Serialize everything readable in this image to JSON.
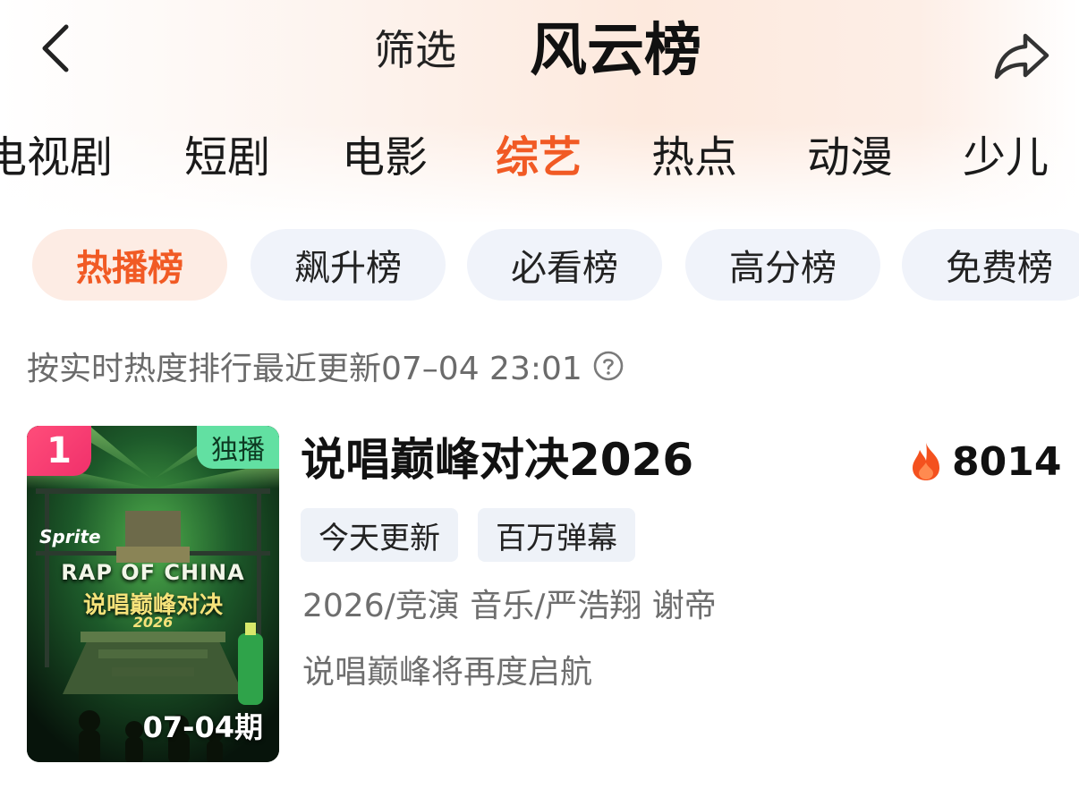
{
  "header": {
    "back_icon": "chevron-left-icon",
    "filter_label": "筛选",
    "title": "风云榜",
    "share_icon": "share-arrow-icon"
  },
  "category_tabs": [
    {
      "label": "电视剧",
      "active": false
    },
    {
      "label": "短剧",
      "active": false
    },
    {
      "label": "电影",
      "active": false
    },
    {
      "label": "综艺",
      "active": true
    },
    {
      "label": "热点",
      "active": false
    },
    {
      "label": "动漫",
      "active": false
    },
    {
      "label": "少儿",
      "active": false
    }
  ],
  "rank_pills": [
    {
      "label": "热播榜",
      "active": true
    },
    {
      "label": "飙升榜",
      "active": false
    },
    {
      "label": "必看榜",
      "active": false
    },
    {
      "label": "高分榜",
      "active": false
    },
    {
      "label": "免费榜",
      "active": false
    }
  ],
  "update_info": {
    "text": "按实时热度排行最近更新07–04 23:01",
    "help_icon": "question-circle-icon"
  },
  "items": [
    {
      "rank": "1",
      "exclusive_badge": "独播",
      "episode": "07-04期",
      "poster_brand": "Sprite",
      "poster_title": "RAP OF CHINA",
      "poster_subtitle": "说唱巅峰对决",
      "poster_year": "2026",
      "title": "说唱巅峰对决2026",
      "heat_icon": "flame-icon",
      "heat": "8014",
      "tags": [
        "今天更新",
        "百万弹幕"
      ],
      "meta": "2026/竞演 音乐/严浩翔 谢帝",
      "description": "说唱巅峰将再度启航"
    }
  ],
  "colors": {
    "accent": "#f15a24",
    "rank_badge": "#f0306b",
    "exclusive_badge": "#62e0a2",
    "pill_bg": "#f0f3fa",
    "pill_active_bg": "#fdece4"
  }
}
